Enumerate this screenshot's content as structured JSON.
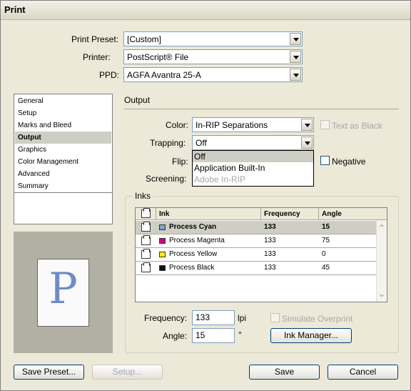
{
  "window": {
    "title": "Print"
  },
  "top": {
    "preset_label": "Print Preset:",
    "preset_value": "[Custom]",
    "printer_label": "Printer:",
    "printer_value": "PostScript® File",
    "ppd_label": "PPD:",
    "ppd_value": "AGFA Avantra 25-A"
  },
  "sidebar": {
    "items": [
      "General",
      "Setup",
      "Marks and Bleed",
      "Output",
      "Graphics",
      "Color Management",
      "Advanced",
      "Summary"
    ],
    "selected_index": 3
  },
  "preview": {
    "glyph": "P"
  },
  "output": {
    "section_title": "Output",
    "color_label": "Color:",
    "color_value": "In-RIP Separations",
    "text_as_black": "Text as Black",
    "trapping_label": "Trapping:",
    "trapping_value": "Off",
    "flip_label": "Flip:",
    "negative_label": "Negative",
    "screening_label": "Screening:",
    "trapping_options": [
      "Off",
      "Application Built-In",
      "Adobe In-RIP"
    ]
  },
  "inks": {
    "group_title": "Inks",
    "columns": [
      "Ink",
      "Frequency",
      "Angle"
    ],
    "rows": [
      {
        "name": "Process Cyan",
        "frequency": "133",
        "angle": "15",
        "color": "#7f9fd0"
      },
      {
        "name": "Process Magenta",
        "frequency": "133",
        "angle": "75",
        "color": "#d4007f"
      },
      {
        "name": "Process Yellow",
        "frequency": "133",
        "angle": "0",
        "color": "#ffee00"
      },
      {
        "name": "Process Black",
        "frequency": "133",
        "angle": "45",
        "color": "#111111"
      }
    ],
    "frequency_label": "Frequency:",
    "frequency_value": "133",
    "frequency_unit": "lpi",
    "angle_label": "Angle:",
    "angle_value": "15",
    "angle_unit": "°",
    "simulate_overprint": "Simulate Overprint",
    "ink_manager_button": "Ink Manager..."
  },
  "footer": {
    "save_preset": "Save Preset...",
    "setup": "Setup...",
    "save": "Save",
    "cancel": "Cancel"
  }
}
